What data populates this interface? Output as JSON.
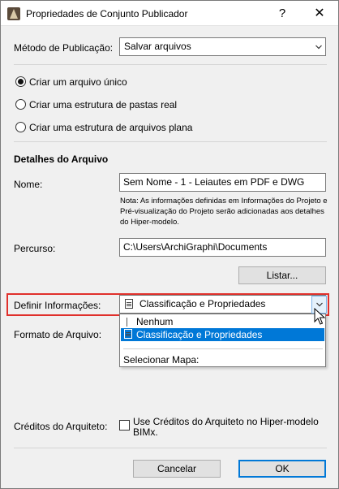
{
  "window": {
    "title": "Propriedades de Conjunto Publicador",
    "help_label": "?",
    "close_label": "✕"
  },
  "publish_method": {
    "label": "Método de Publicação:",
    "value": "Salvar arquivos"
  },
  "radio_options": [
    {
      "label": "Criar um arquivo único",
      "checked": true
    },
    {
      "label": "Criar uma estrutura de pastas real",
      "checked": false
    },
    {
      "label": "Criar uma estrutura de arquivos plana",
      "checked": false
    }
  ],
  "file_details": {
    "heading": "Detalhes do Arquivo",
    "name_label": "Nome:",
    "name_value": "Sem Nome - 1 - Leiautes em PDF e DWG",
    "note": "Nota: As informações definidas em Informações do Projeto e Pré-visualização do Projeto serão adicionadas aos detalhes do Hiper-modelo.",
    "path_label": "Percurso:",
    "path_value": "C:\\Users\\ArchiGraphi\\Documents",
    "list_button": "Listar..."
  },
  "define_info": {
    "label": "Definir Informações:",
    "value": "Classificação e Propriedades",
    "options": [
      "Nenhum",
      "Classificação e Propriedades",
      "Selecionar Mapa:"
    ]
  },
  "file_format": {
    "label": "Formato de Arquivo:"
  },
  "architect_credits": {
    "label": "Créditos do Arquiteto:",
    "checkbox_label": "Use Créditos do Arquiteto no Hiper-modelo BIMx.",
    "checked": false
  },
  "footer": {
    "cancel_label": "Cancelar",
    "ok_label": "OK"
  },
  "colors": {
    "accent": "#0078d7",
    "highlight_border": "#e0302b"
  }
}
